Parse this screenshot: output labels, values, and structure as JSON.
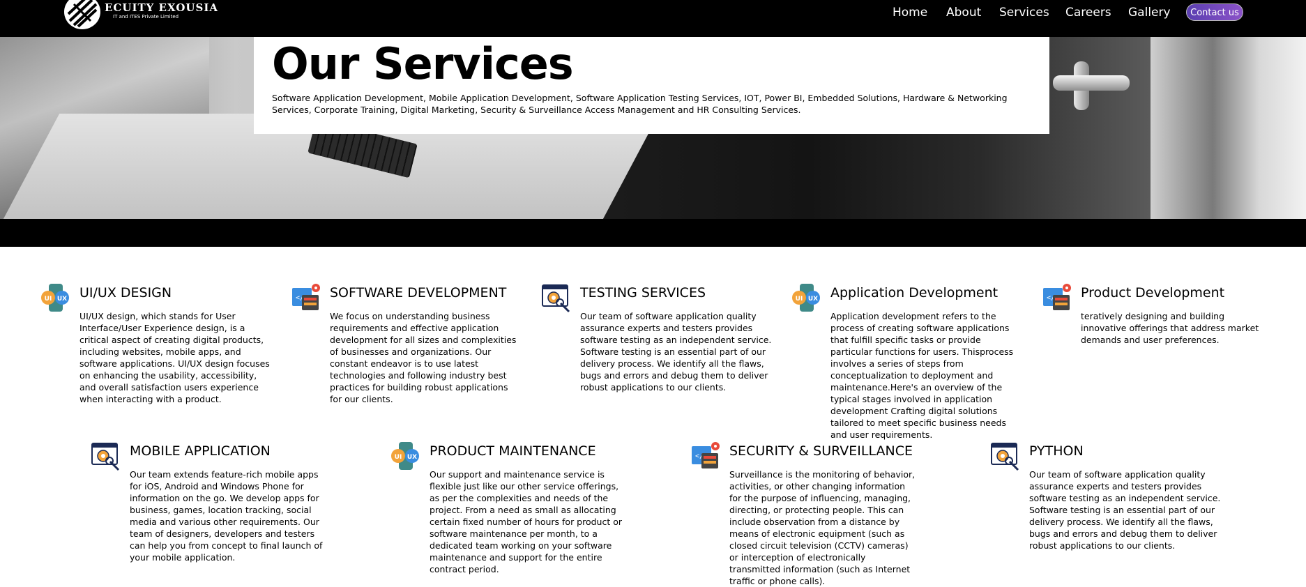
{
  "brand": {
    "name": "ECUITY EXOUSIA",
    "tagline": "IT and ITES Private Limited"
  },
  "nav": {
    "links": [
      "Home",
      "About",
      "Services",
      "Careers",
      "Gallery"
    ],
    "contact_label": "Contact us"
  },
  "hero": {
    "title": "Our Services",
    "description": "Software Application Development, Mobile Application Development, Software Application Testing Services, IOT, Power BI, Embedded Solutions, Hardware & Networking Services, Corporate Training, Digital Marketing, Security & Surveillance Access Management and HR Consulting Services."
  },
  "services_row1": [
    {
      "icon": "ui-ux-phone-icon",
      "title": "UI/UX DESIGN",
      "text": "UI/UX design, which stands for User Interface/User Experience design, is a critical aspect of creating digital products, including websites, mobile apps, and software applications. UI/UX design focuses on enhancing the usability, accessibility, and overall satisfaction users experience when interacting with a product."
    },
    {
      "icon": "software-dev-window-icon",
      "title": "SOFTWARE DEVELOPMENT",
      "text": "We focus on understanding business requirements and effective application development for all sizes and complexities of businesses and organizations. Our constant endeavor is to use latest technologies and following industry best practices for building robust applications for our clients."
    },
    {
      "icon": "testing-gear-window-icon",
      "title": "TESTING SERVICES",
      "text": "Our team of software application quality assurance experts and testers provides software testing as an independent service. Software testing is an essential part of our delivery process. We identify all the flaws, bugs and errors and debug them to deliver robust applications to our clients."
    },
    {
      "icon": "ui-ux-phone-icon",
      "title": "Application Development",
      "text": "Application development refers to the process of creating software applications that fulfill specific tasks or provide particular functions for users. Thisprocess involves a series of steps from conceptualization to deployment and maintenance.Here's an overview of the typical stages involved in application development Crafting digital solutions tailored to meet specific business needs and user requirements."
    },
    {
      "icon": "software-dev-window-icon",
      "title": "Product Development",
      "text": "teratively designing and building innovative offerings that address market demands and user preferences."
    }
  ],
  "services_row2": [
    {
      "icon": "testing-gear-window-icon",
      "title": "MOBILE APPLICATION",
      "text": "Our team extends feature-rich mobile apps for iOS, Android and Windows Phone for information on the go. We develop apps for business, games, location tracking, social media and various other requirements. Our team of designers, developers and testers can help you from concept to final launch of your mobile application."
    },
    {
      "icon": "ui-ux-phone-icon",
      "title": "PRODUCT MAINTENANCE",
      "text": "Our support and maintenance service is flexible just like our other service offerings, as per the complexities and needs of the project. From a need as small as allocating certain fixed number of hours for product or software maintenance per month, to a dedicated team working on your software maintenance and support for the entire contract period."
    },
    {
      "icon": "software-dev-window-icon",
      "title": "SECURITY & SURVEILLANCE",
      "text": "Surveillance is the monitoring of behavior, activities, or other changing information for the purpose of influencing, managing, directing, or protecting people. This can include observation from a distance by means of electronic equipment (such as closed circuit television (CCTV) cameras) or interception of electronically transmitted information (such as Internet traffic or phone calls)."
    },
    {
      "icon": "testing-gear-window-icon",
      "title": "PYTHON",
      "text": "Our team of software application quality assurance experts and testers provides software testing as an independent service. Software testing is an essential part of our delivery process. We identify all the flaws, bugs and errors and debug them to deliver robust applications to our clients."
    }
  ]
}
